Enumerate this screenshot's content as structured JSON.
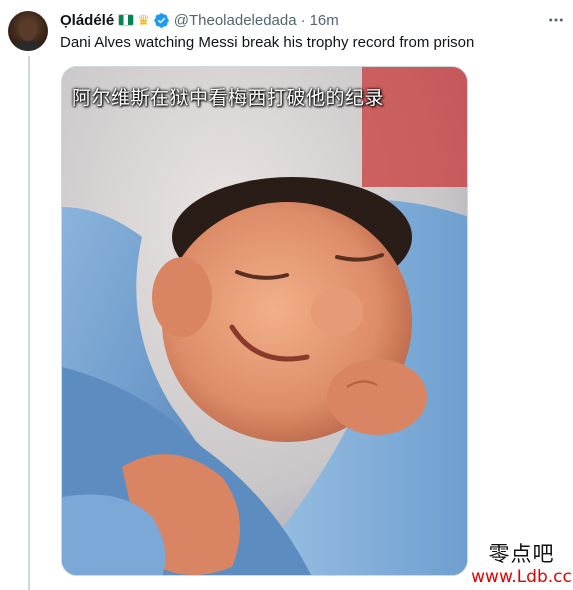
{
  "tweet": {
    "author_name": "Ọládélé",
    "author_badges": [
      "nigeria-flag-icon",
      "crown-icon"
    ],
    "verified": true,
    "handle": "@Theoladeledada",
    "separator": "·",
    "time": "16m",
    "text": "Dani Alves watching Messi break his trophy record from prison",
    "media": {
      "caption": "阿尔维斯在狱中看梅西打破他的纪录",
      "alt": "sleeping smiling baby wrapped in blue blanket"
    }
  },
  "watermark": {
    "chinese": "零点吧",
    "url": "www.Ldb.cc"
  },
  "colors": {
    "verified_blue": "#1d9bf0",
    "secondary_text": "#536471",
    "watermark_red": "#e60000"
  },
  "icons": {
    "more": "more-icon",
    "verified": "verified-badge-icon"
  }
}
